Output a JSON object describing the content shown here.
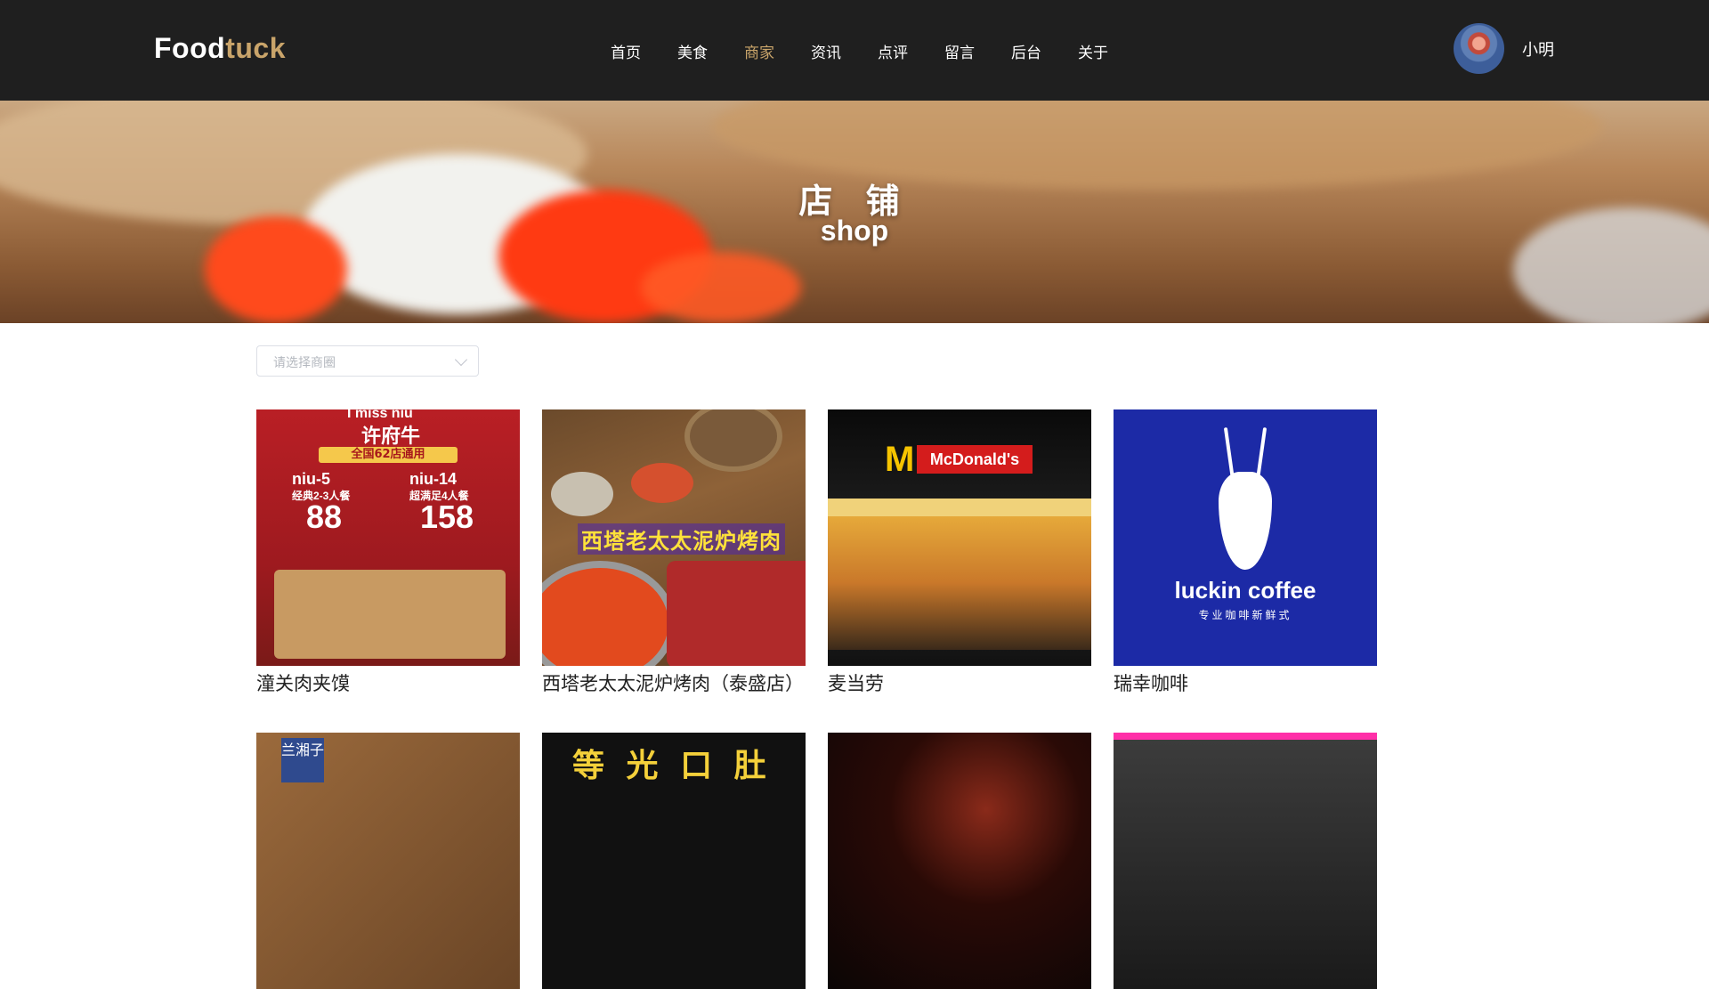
{
  "header": {
    "logo_part1": "Food",
    "logo_part2": "tuck",
    "nav": [
      "首页",
      "美食",
      "商家",
      "资讯",
      "点评",
      "留言",
      "后台",
      "关于"
    ],
    "active_nav": "商家",
    "user_name": "小明",
    "logo_colors": {
      "primary": "#ffffff",
      "accent": "#c9a46a"
    }
  },
  "banner": {
    "title": "店 铺",
    "subtitle": "shop"
  },
  "filter": {
    "placeholder": "请选择商圈"
  },
  "shops": [
    {
      "name": "潼关肉夹馍"
    },
    {
      "name": "西塔老太太泥炉烤肉（泰盛店）"
    },
    {
      "name": "麦当劳"
    },
    {
      "name": "瑞幸咖啡"
    }
  ],
  "shop_images": {
    "s1": {
      "line1": "I miss niu",
      "brand": "许府牛",
      "band_text": "全国62店通用",
      "combo1_name": "niu-5",
      "combo1_desc": "经典2-3人餐",
      "combo1_price": "88",
      "combo2_name": "niu-14",
      "combo2_desc": "超满足4人餐",
      "combo2_price": "158"
    },
    "s2": {
      "label": "西塔老太太泥炉烤肉"
    },
    "s3": {
      "sign": "McDonald's",
      "logo": "M"
    },
    "s4": {
      "brand": "luckin coffee",
      "slogan": "专业咖啡新鲜式"
    },
    "s5": {
      "tag": "兰湘子"
    },
    "s6": {
      "text": "等 光 口 肚"
    }
  },
  "colors": {
    "header_bg": "#1f1f1f",
    "nav_active": "#c9a46a"
  }
}
